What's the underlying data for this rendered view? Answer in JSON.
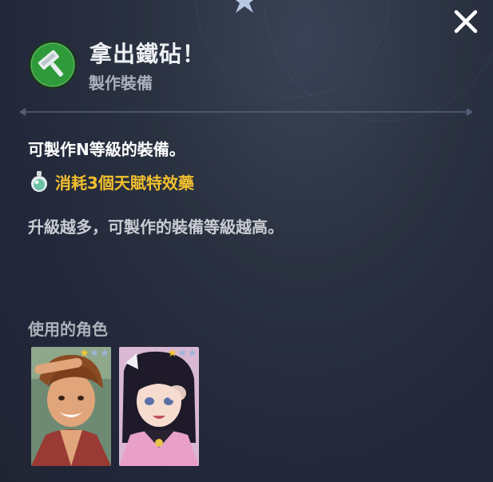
{
  "header": {
    "title": "拿出鐵砧！",
    "subtitle": "製作裝備",
    "skill_icon": "hammer-icon",
    "close_icon": "close-icon"
  },
  "body": {
    "description": "可製作N等級的裝備。",
    "cost": {
      "icon": "potion-icon",
      "text": "消耗3個天賦特效藥"
    },
    "note": "升級越多，可製作的裝備等級越高。"
  },
  "characters": {
    "label": "使用的角色",
    "cards": [
      {
        "portrait": "brown-haired-boy-portrait",
        "stars": [
          "★",
          "★",
          "★"
        ],
        "filled_stars": 1
      },
      {
        "portrait": "black-haired-girl-portrait",
        "stars": [
          "★",
          "★",
          "★"
        ],
        "filled_stars": 1
      }
    ]
  },
  "colors": {
    "background": "#232a38",
    "title": "#eef0f4",
    "subtitle": "#aab0bc",
    "cost_accent": "#f2c02e",
    "skill_icon_green": "#2e9a3a",
    "star_filled": "#f4c430",
    "star_empty": "#9fb4d8"
  }
}
